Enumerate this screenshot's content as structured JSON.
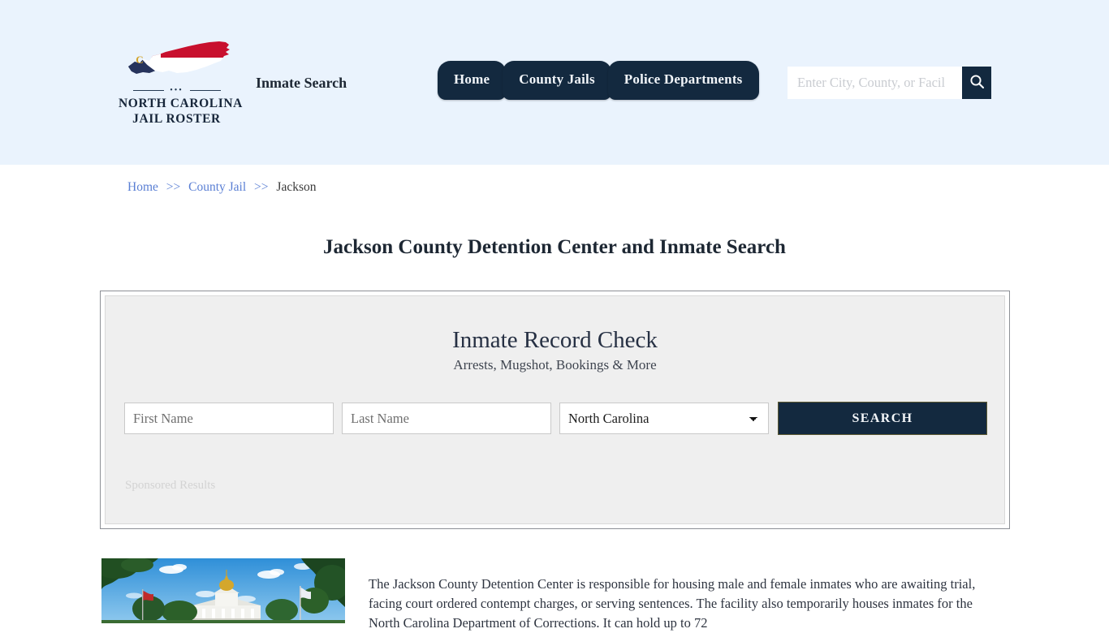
{
  "header": {
    "logo": {
      "line1": "NORTH CAROLINA",
      "line2": "JAIL ROSTER",
      "dots": "•••",
      "map_icon": "north-carolina-state-map-icon"
    },
    "tagline": "Inmate Search",
    "nav": [
      {
        "label": "Home"
      },
      {
        "label": "County Jails"
      },
      {
        "label": "Police Departments"
      }
    ],
    "search": {
      "value": "",
      "placeholder": "Enter City, County, or Facil",
      "button_icon": "search-icon"
    },
    "background_color": "#eaf3fd",
    "accent_color": "#13293f"
  },
  "breadcrumb": {
    "items": [
      {
        "label": "Home",
        "link": true
      },
      {
        "label": "County Jail",
        "link": true
      },
      {
        "label": "Jackson",
        "link": false
      }
    ],
    "separator": ">>",
    "link_color": "#5a7fd4"
  },
  "page": {
    "title": "Jackson County Detention Center and Inmate Search"
  },
  "record_check": {
    "title": "Inmate Record Check",
    "subtitle": "Arrests, Mugshot, Bookings & More",
    "first_name": {
      "value": "",
      "placeholder": "First Name"
    },
    "last_name": {
      "value": "",
      "placeholder": "Last Name"
    },
    "state": {
      "selected": "North Carolina",
      "options": [
        "North Carolina"
      ]
    },
    "search_button": "SEARCH",
    "sponsored_label": "Sponsored Results",
    "panel_background": "#efefef",
    "button_color": "#13293f"
  },
  "article": {
    "photo_alt": "jackson-county-courthouse-photo",
    "body": "The Jackson County Detention Center is responsible for housing male and female inmates who are awaiting trial, facing court ordered contempt charges, or serving sentences. The facility also temporarily houses inmates for the North Carolina Department of Corrections. It can hold up to 72"
  }
}
